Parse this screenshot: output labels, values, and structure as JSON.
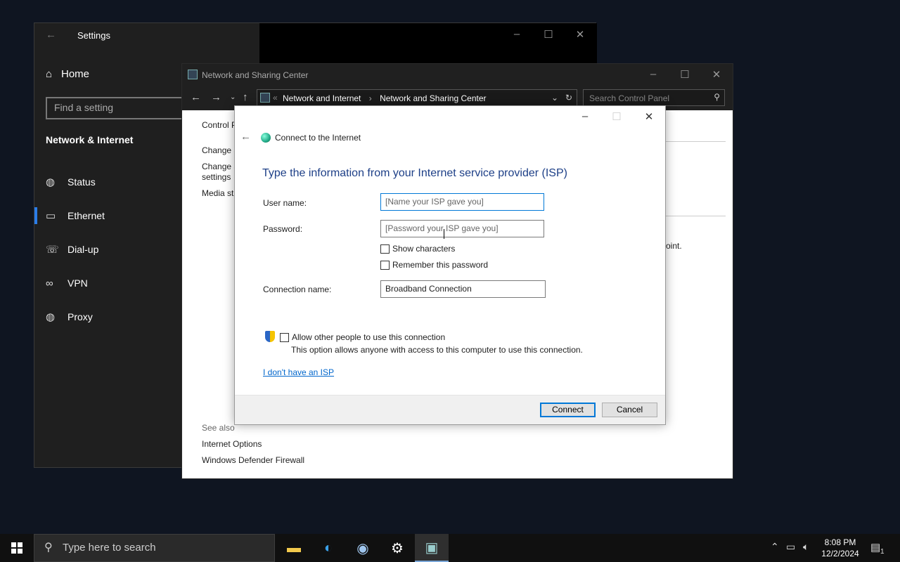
{
  "settings": {
    "title": "Settings",
    "back_glyph": "←",
    "home_label": "Home",
    "search_placeholder": "Find a setting",
    "section_title": "Network & Internet",
    "nav": [
      {
        "label": "Status",
        "icon": "globe-icon"
      },
      {
        "label": "Ethernet",
        "icon": "ethernet-icon"
      },
      {
        "label": "Dial-up",
        "icon": "dialup-icon"
      },
      {
        "label": "VPN",
        "icon": "vpn-icon"
      },
      {
        "label": "Proxy",
        "icon": "globe-icon"
      }
    ],
    "selected": "Ethernet",
    "accent": "#2b7de9"
  },
  "network_window": {
    "title": "Network and Sharing Center",
    "breadcrumb": [
      "Network and Internet",
      "Network and Sharing Center"
    ],
    "search_placeholder": "Search Control Panel",
    "left_links": [
      "Control Panel Home",
      "Change adapter settings",
      "Change advanced sharing settings",
      "Media streaming options"
    ],
    "left_links_visible": [
      "Control P",
      "Change a",
      "Change a",
      "settings",
      "Media st"
    ],
    "right_text": "oint.",
    "see_also": "See also",
    "see_also_links": [
      "Internet Options",
      "Windows Defender Firewall"
    ]
  },
  "dialog": {
    "header": "Connect to the Internet",
    "heading": "Type the information from your Internet service provider (ISP)",
    "username_label": "User name:",
    "username_placeholder": "[Name your ISP gave you]",
    "password_label": "Password:",
    "password_placeholder": "[Password your ISP gave you]",
    "show_characters": "Show characters",
    "remember_password": "Remember this password",
    "connection_label": "Connection name:",
    "connection_value": "Broadband Connection",
    "allow_others": "Allow other people to use this connection",
    "allow_note": "This option allows anyone with access to this computer to use this connection.",
    "no_isp_link": "I don't have an ISP",
    "connect_button": "Connect",
    "cancel_button": "Cancel"
  },
  "taskbar": {
    "search_placeholder": "Type here to search",
    "apps": [
      "file-explorer-icon",
      "edge-icon",
      "steam-icon",
      "settings-gear-icon",
      "control-panel-icon"
    ],
    "time": "8:08 PM",
    "date": "12/2/2024",
    "notification_count": "1"
  }
}
